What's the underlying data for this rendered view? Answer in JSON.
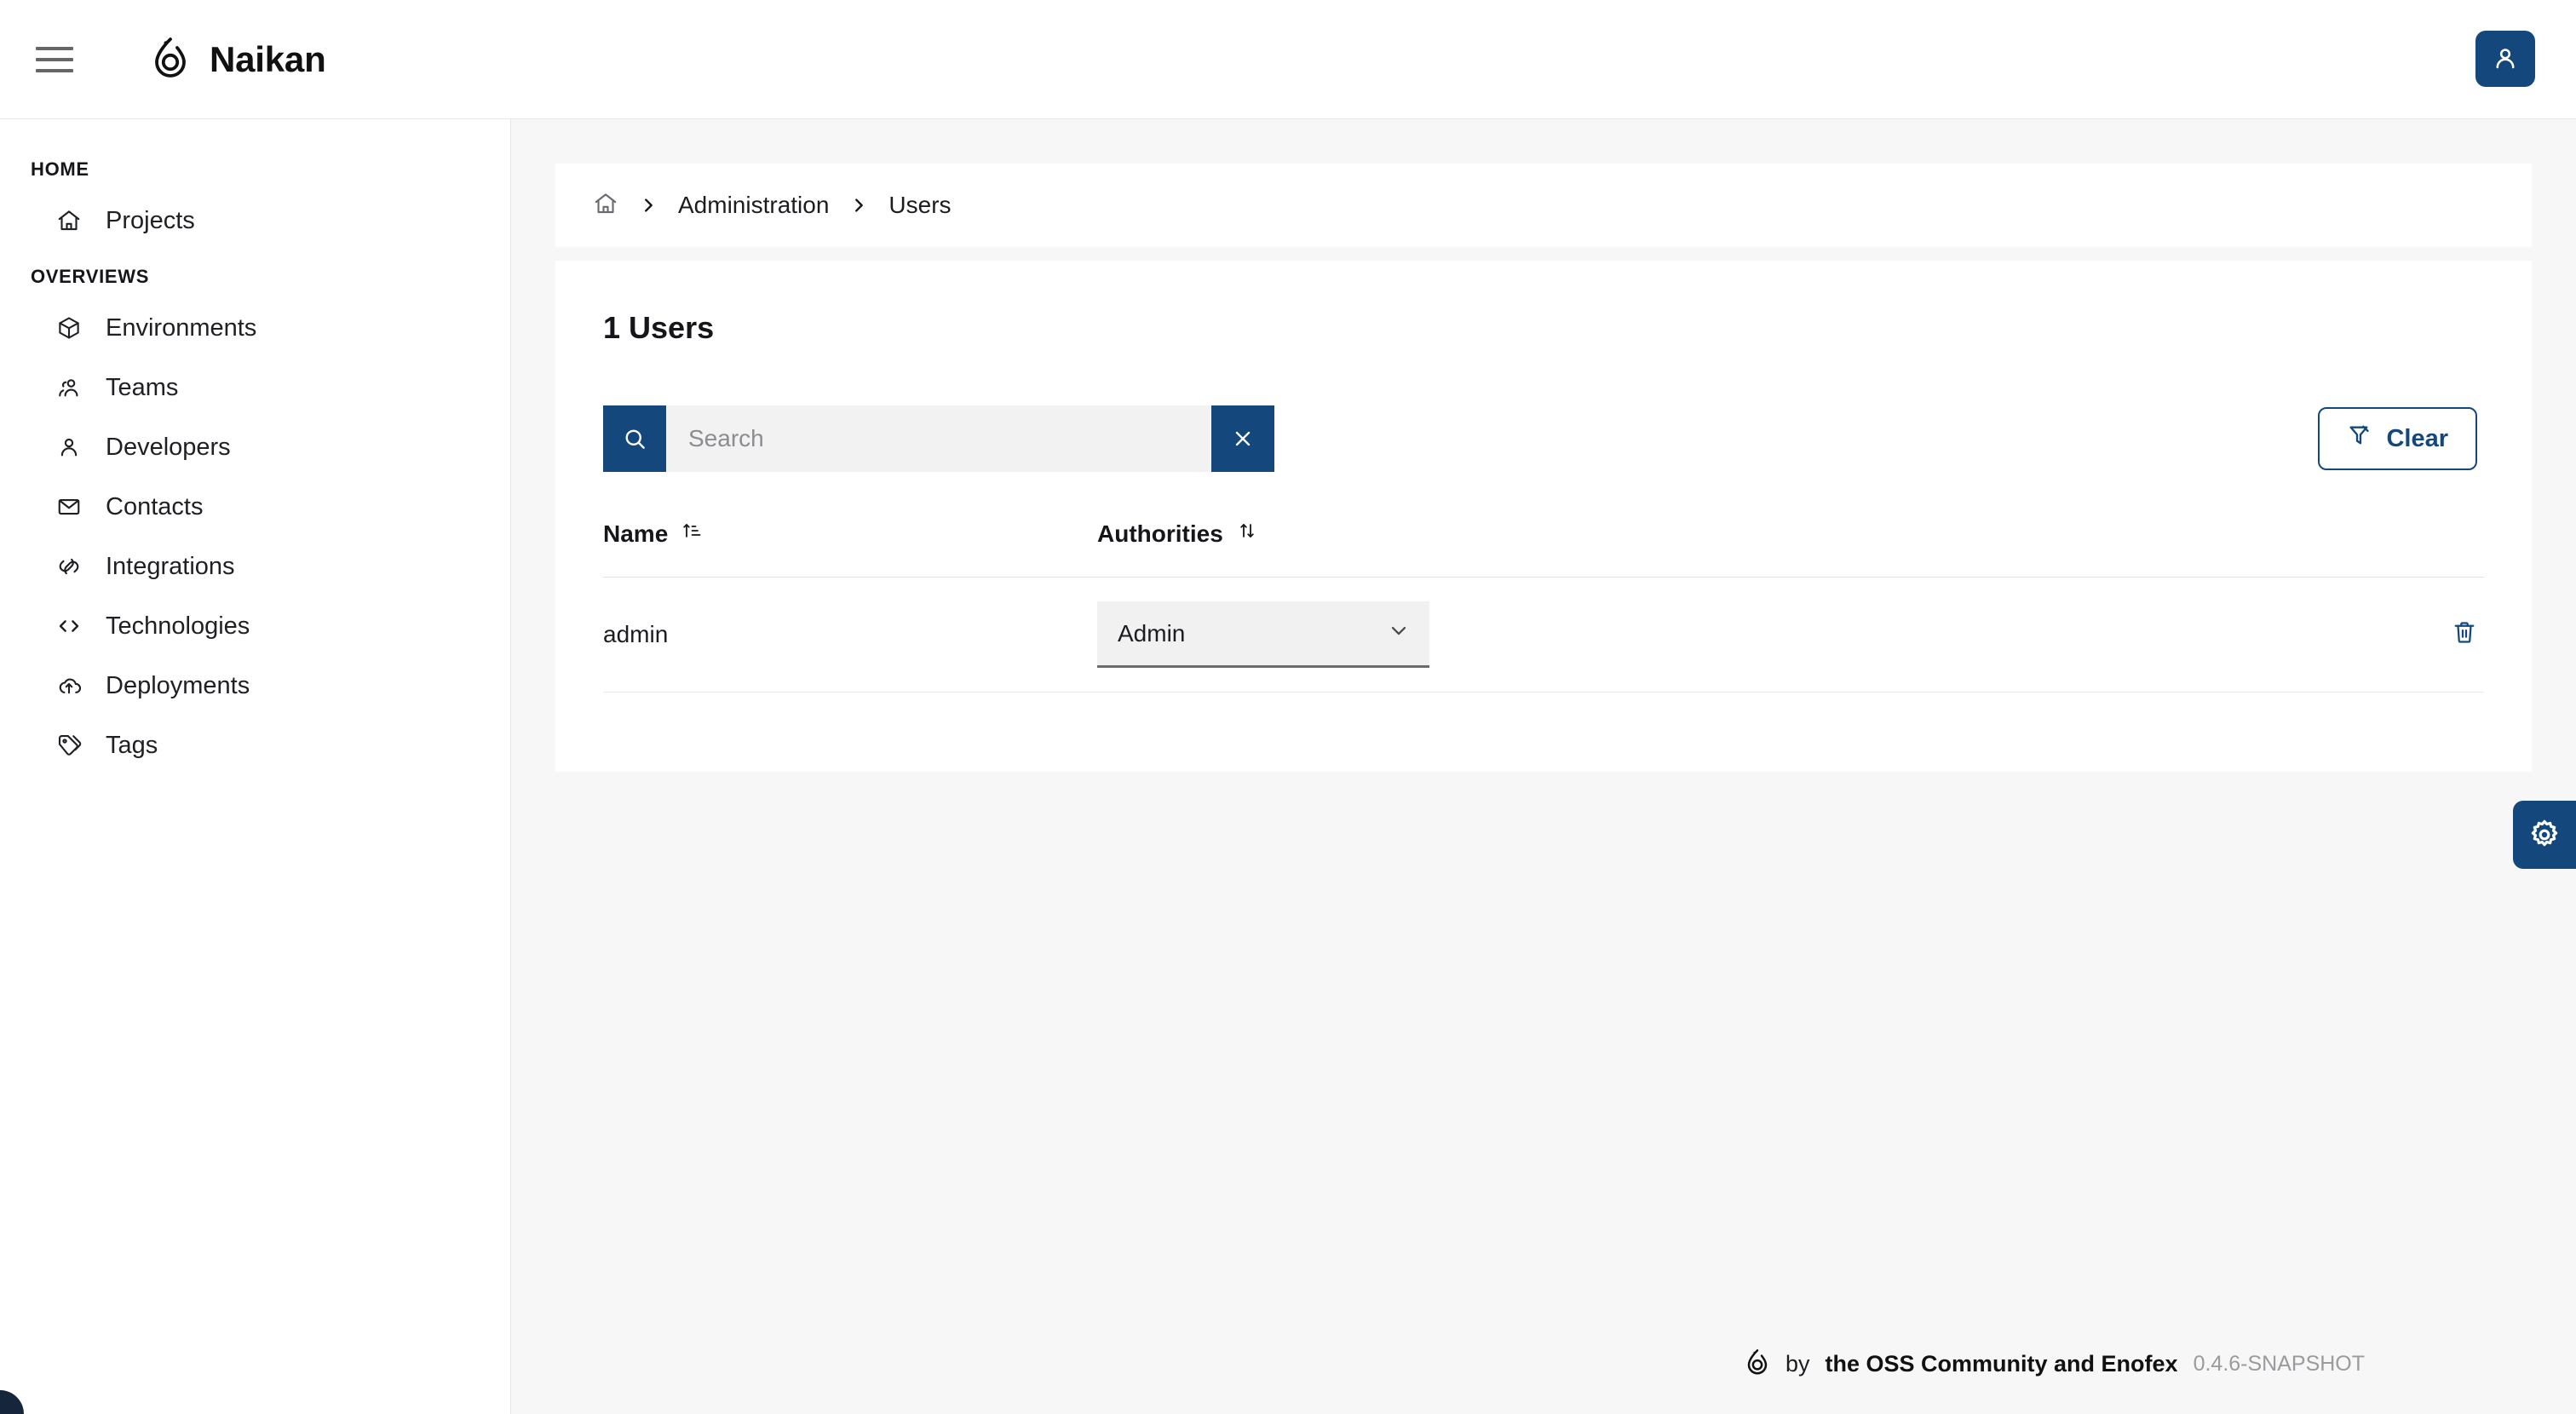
{
  "header": {
    "menu_icon": "hamburger-icon",
    "logo_icon": "naikan-drop-logo",
    "brand": "Naikan",
    "account_icon": "user-icon"
  },
  "sidebar": {
    "sections": [
      {
        "title": "HOME",
        "items": [
          {
            "label": "Projects",
            "icon": "house-icon"
          }
        ]
      },
      {
        "title": "OVERVIEWS",
        "items": [
          {
            "label": "Environments",
            "icon": "cube-icon"
          },
          {
            "label": "Teams",
            "icon": "users-group-icon"
          },
          {
            "label": "Developers",
            "icon": "user-icon"
          },
          {
            "label": "Contacts",
            "icon": "mail-icon"
          },
          {
            "label": "Integrations",
            "icon": "link-icon"
          },
          {
            "label": "Technologies",
            "icon": "code-brackets-icon"
          },
          {
            "label": "Deployments",
            "icon": "cloud-upload-icon"
          },
          {
            "label": "Tags",
            "icon": "tag-icon"
          }
        ]
      }
    ]
  },
  "breadcrumb": {
    "home_icon": "home-icon",
    "separator_icon": "chevron-right-icon",
    "items": [
      "Administration",
      "Users"
    ]
  },
  "page": {
    "title": "1 Users"
  },
  "search": {
    "value": "",
    "placeholder": "Search",
    "search_icon": "search-icon",
    "clear_icon": "close-x-icon"
  },
  "clear_filter": {
    "label": "Clear",
    "icon": "filter-off-icon"
  },
  "table": {
    "columns": [
      {
        "label": "Name",
        "sort_icon": "sort-ascending-icon"
      },
      {
        "label": "Authorities",
        "sort_icon": "sort-updown-icon"
      }
    ],
    "rows": [
      {
        "name": "admin",
        "authority": "Admin",
        "authority_chevron": "chevron-down-icon",
        "delete_icon": "trash-icon"
      }
    ]
  },
  "settings_fab": {
    "icon": "gear-icon"
  },
  "footer": {
    "logo_icon": "naikan-drop-logo",
    "by": "by",
    "org": "the OSS Community and Enofex",
    "version": "0.4.6-SNAPSHOT"
  },
  "colors": {
    "brand_blue": "#14487d",
    "page_bg": "#f7f7f8",
    "card_bg": "#ffffff",
    "field_bg": "#f1f1f2",
    "muted_text": "#8c8d92"
  }
}
